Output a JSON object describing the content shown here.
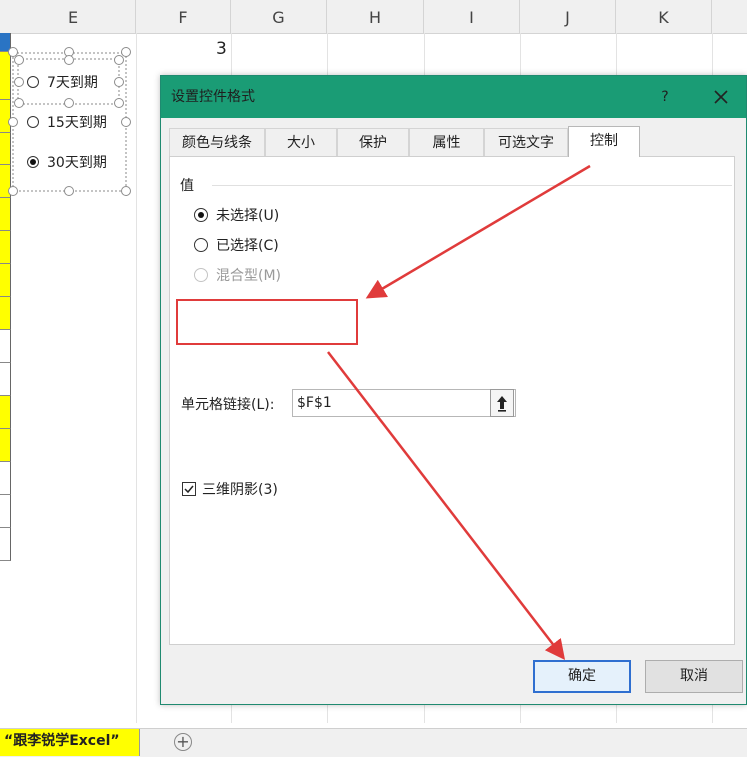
{
  "spreadsheet": {
    "columns": [
      "E",
      "F",
      "G",
      "H",
      "I",
      "J",
      "K"
    ],
    "cell_f1_value": "3",
    "option_buttons": [
      {
        "label": "7天到期",
        "selected": false
      },
      {
        "label": "15天到期",
        "selected": false
      },
      {
        "label": "30天到期",
        "selected": true
      }
    ],
    "strip_highlight_color": "#ffff00",
    "sheet_tab": "“跟李锐学Excel”",
    "add_sheet_icon": "plus-circle-icon"
  },
  "dialog": {
    "title": "设置控件格式",
    "help": "?",
    "accent_color": "#1a9c75",
    "tabs": [
      "颜色与线条",
      "大小",
      "保护",
      "属性",
      "可选文字",
      "控制"
    ],
    "active_tab": "控制",
    "value_group_label": "值",
    "value_options": [
      {
        "label": "未选择(U)",
        "selected": true,
        "disabled": false
      },
      {
        "label": "已选择(C)",
        "selected": false,
        "disabled": false
      },
      {
        "label": "混合型(M)",
        "selected": false,
        "disabled": true
      }
    ],
    "cell_link_label": "单元格链接(L):",
    "cell_link_value": "$F$1",
    "shading_label": "三维阴影(3)",
    "shading_checked": true,
    "ok_label": "确定",
    "cancel_label": "取消"
  },
  "annotations": {
    "highlight_color": "#e03b3b"
  }
}
